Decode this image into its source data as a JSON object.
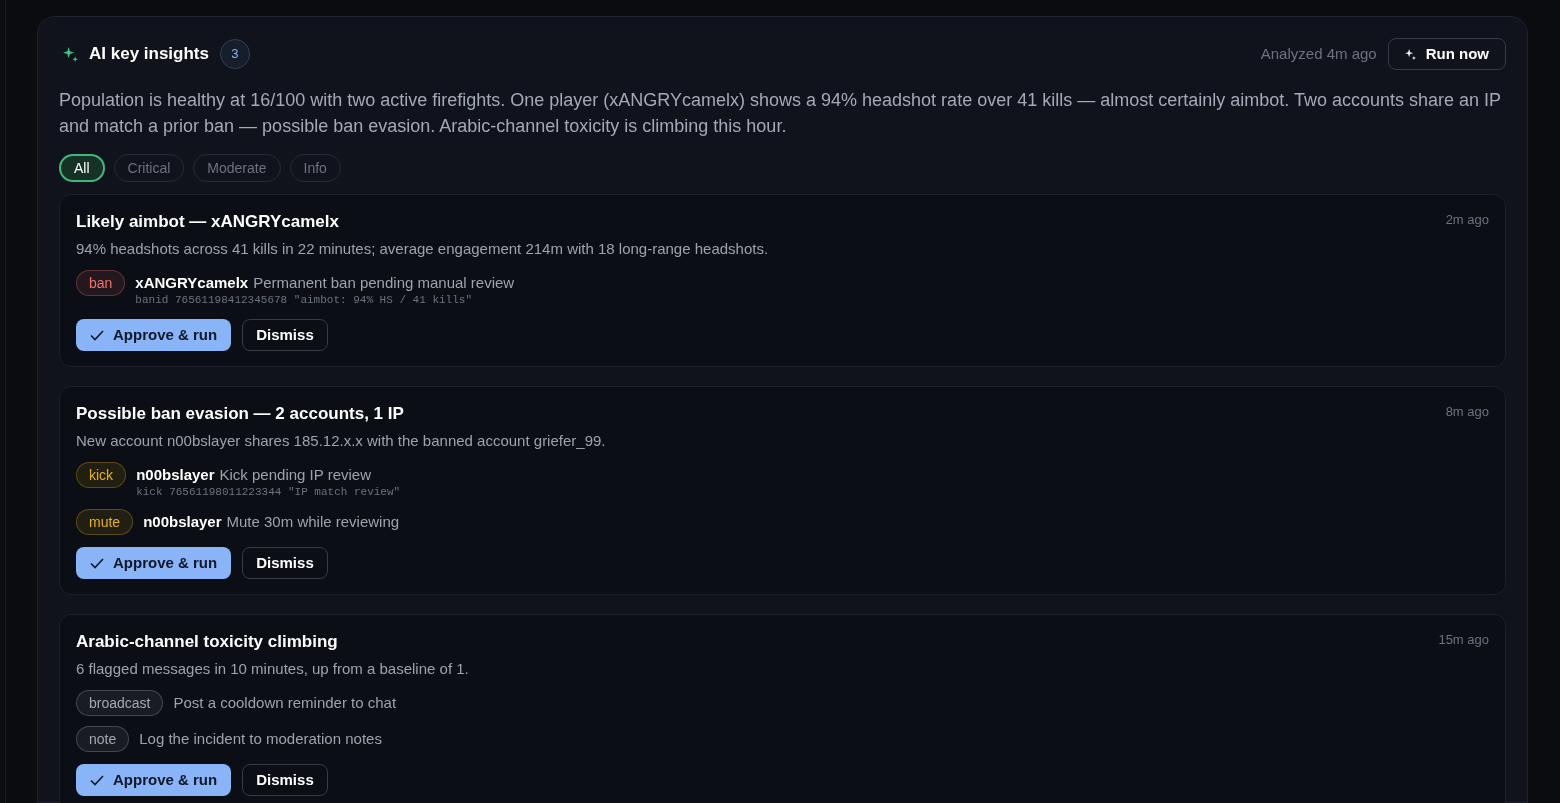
{
  "panel": {
    "title": "AI key insights",
    "count": "3",
    "analyzed": "Analyzed 4m ago",
    "run_button": "Run now",
    "summary": "Population is healthy at 16/100 with two active firefights. One player (xANGRYcamelx) shows a 94% headshot rate over 41 kills — almost certainly aimbot. Two accounts share an IP and match a prior ban — possible ban evasion. Arabic-channel toxicity is climbing this hour.",
    "filters": [
      {
        "label": "All",
        "selected": true
      },
      {
        "label": "Critical",
        "selected": false
      },
      {
        "label": "Moderate",
        "selected": false
      },
      {
        "label": "Info",
        "selected": false
      }
    ]
  },
  "cards": [
    {
      "title": "Likely aimbot — xANGRYcamelx",
      "time": "2m ago",
      "description": "94% headshots across 41 kills in 22 minutes; average engagement 214m with 18 long-range headshots.",
      "actions": [
        {
          "tag": "ban",
          "color": "#f87171",
          "player": "xANGRYcamelx",
          "text": "Permanent ban pending manual review",
          "command": "banid 76561198412345678 \"aimbot: 94% HS / 41 kills\""
        }
      ],
      "approve_button": "Approve & run",
      "dismiss_button": "Dismiss"
    },
    {
      "title": "Possible ban evasion — 2 accounts, 1 IP",
      "time": "8m ago",
      "description": "New account n00bslayer shares 185.12.x.x with the banned account griefer_99.",
      "actions": [
        {
          "tag": "kick",
          "color": "#eab308",
          "player": "n00bslayer",
          "text": "Kick pending IP review",
          "command": "kick 76561198011223344 \"IP match review\""
        },
        {
          "tag": "mute",
          "color": "#eab308",
          "player": "n00bslayer",
          "text": "Mute 30m while reviewing"
        }
      ],
      "approve_button": "Approve & run",
      "dismiss_button": "Dismiss"
    },
    {
      "title": "Arabic-channel toxicity climbing",
      "time": "15m ago",
      "description": "6 flagged messages in 10 minutes, up from a baseline of 1.",
      "actions": [
        {
          "tag": "broadcast",
          "color": "#a1a8b5",
          "text": "Post a cooldown reminder to chat"
        },
        {
          "tag": "note",
          "color": "#a1a8b5",
          "text": "Log the incident to moderation notes"
        }
      ],
      "approve_button": "Approve & run",
      "dismiss_button": "Dismiss"
    }
  ]
}
